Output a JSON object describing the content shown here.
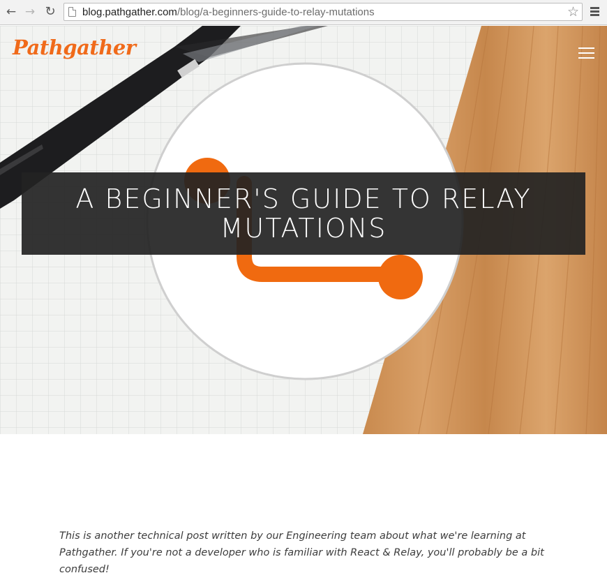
{
  "browser": {
    "url_host": "blog.pathgather.com",
    "url_path": "/blog/a-beginners-guide-to-relay-mutations",
    "icons": {
      "back": "arrow-left-icon",
      "forward": "arrow-right-icon",
      "reload": "reload-icon",
      "bookmark": "star-icon",
      "menu": "menu-icon"
    }
  },
  "site": {
    "logo_text": "Pathgather",
    "brand_color": "#f06a1a"
  },
  "hero": {
    "title": "A BEGINNER'S GUIDE TO RELAY MUTATIONS"
  },
  "article": {
    "intro": "This is another technical post written by our Engineering team about what we're learning at Pathgather. If you're not a developer who is familiar with React & Relay, you'll probably be a bit confused!"
  }
}
